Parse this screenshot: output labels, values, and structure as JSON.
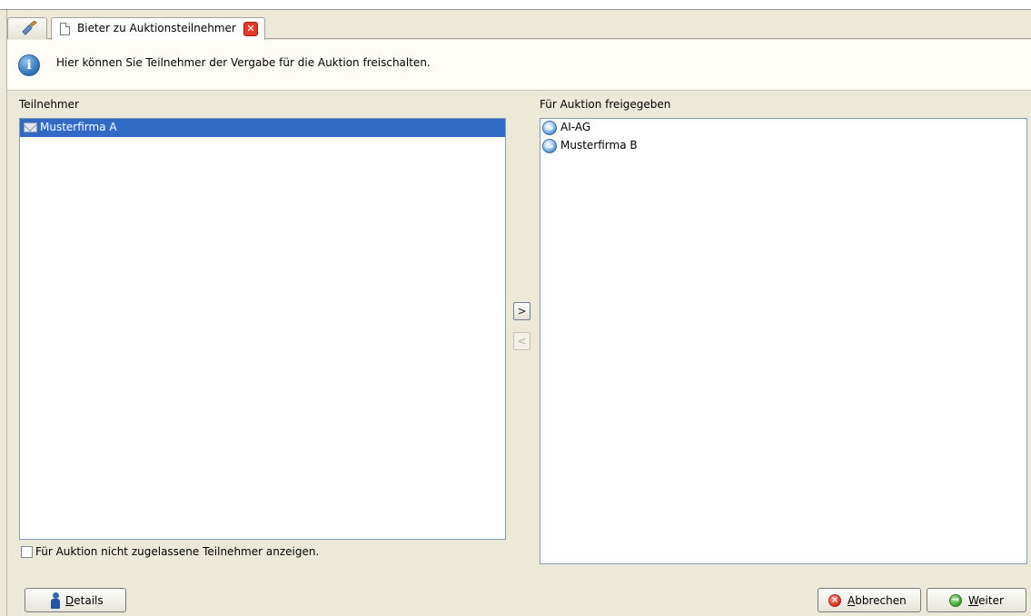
{
  "tabs": {
    "home_icon": "broom-icon",
    "document": {
      "icon": "document-icon",
      "label": "Bieter zu Auktionsteilnehmer",
      "close_icon": "close-icon",
      "close_glyph": "✕"
    }
  },
  "info": {
    "icon": "info-icon",
    "glyph": "i",
    "text": "Hier können Sie Teilnehmer der Vergabe für die Auktion freischalten."
  },
  "left": {
    "title": "Teilnehmer",
    "items": [
      {
        "label": "Musterfirma A",
        "icon": "mail-icon",
        "selected": true
      }
    ],
    "checkbox_label": "Für Auktion nicht zugelassene Teilnehmer anzeigen.",
    "checkbox_checked": false
  },
  "right": {
    "title": "Für Auktion freigegeben",
    "items": [
      {
        "label": "AI-AG",
        "icon": "globe-icon"
      },
      {
        "label": "Musterfirma B",
        "icon": "globe-icon"
      }
    ]
  },
  "move": {
    "add_label": ">",
    "add_enabled": true,
    "remove_label": "<",
    "remove_enabled": false
  },
  "footer": {
    "details_label": "Details",
    "details_icon": "person-icon",
    "cancel_label": "Abbrechen",
    "cancel_icon": "cancel-icon",
    "cancel_glyph": "×",
    "next_label": "Weiter",
    "next_icon": "arrow-right-icon",
    "next_glyph": "→"
  }
}
